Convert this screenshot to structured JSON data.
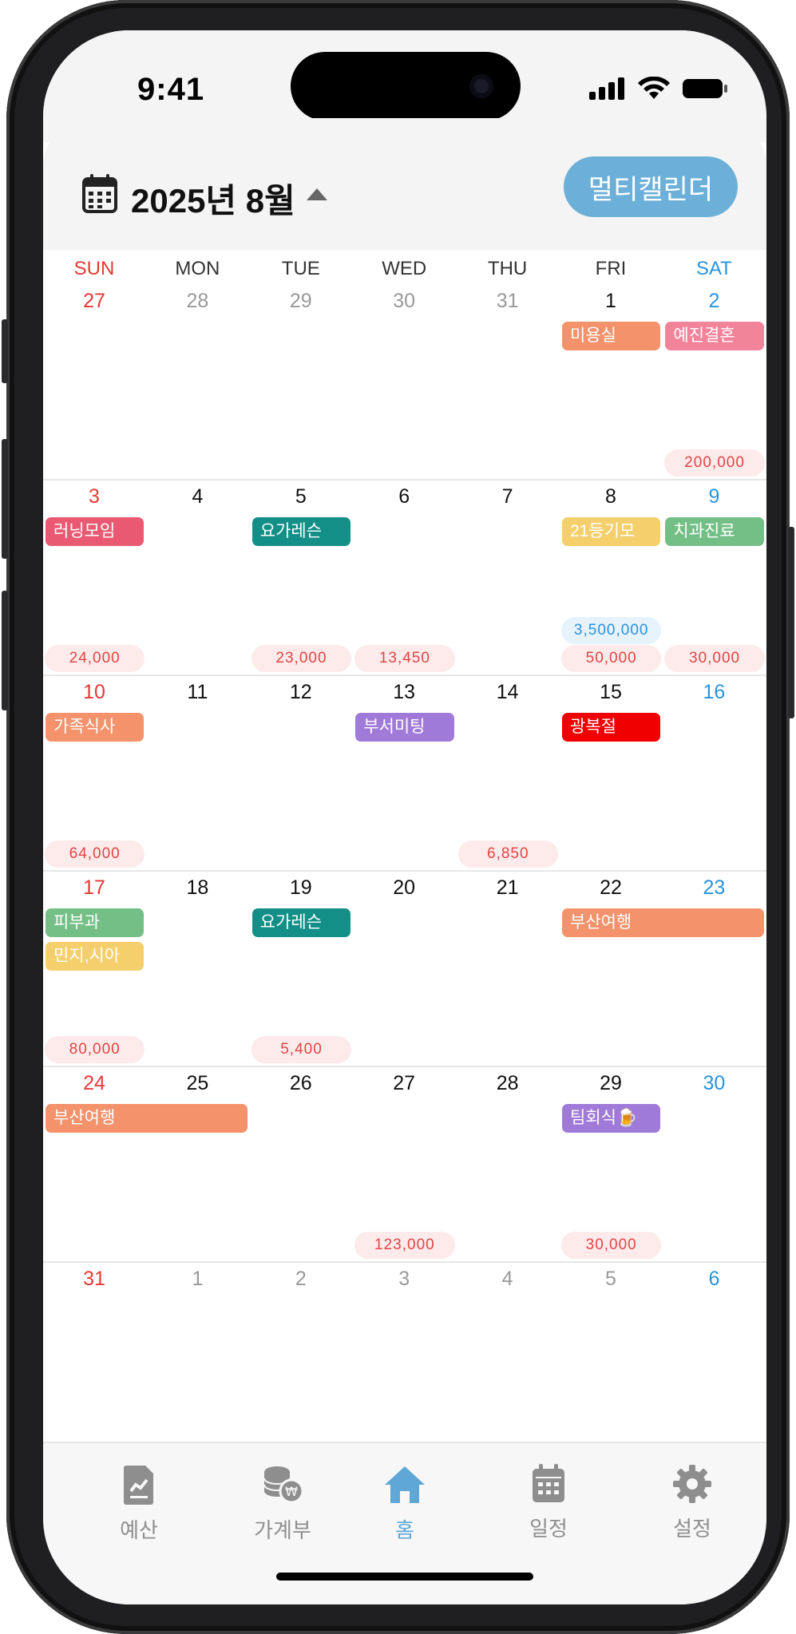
{
  "status": {
    "time": "9:41"
  },
  "header": {
    "month_title": "2025년 8월",
    "multi_button": "멀티캘린더"
  },
  "colors": {
    "accent": "#5fa7d6",
    "sunday": "#e53935",
    "saturday": "#2a93dd",
    "expense": "#e04545",
    "income": "#2a93dd"
  },
  "weekdays": [
    "SUN",
    "MON",
    "TUE",
    "WED",
    "THU",
    "FRI",
    "SAT"
  ],
  "weeks": [
    {
      "days": [
        "27",
        "28",
        "29",
        "30",
        "31",
        "1",
        "2"
      ],
      "events": [
        {
          "label": "미용실",
          "color": "#f4926b"
        },
        {
          "label": "예진결혼",
          "color": "#f2849a"
        }
      ],
      "amounts": [
        {
          "value": "200,000",
          "type": "expense"
        }
      ]
    },
    {
      "days": [
        "3",
        "4",
        "5",
        "6",
        "7",
        "8",
        "9"
      ],
      "events": [
        {
          "label": "러닝모임",
          "color": "#e95a72"
        },
        {
          "label": "요가레슨",
          "color": "#138f87"
        },
        {
          "label": "21등기모",
          "color": "#f5cf6b"
        },
        {
          "label": "치과진료",
          "color": "#74bf86"
        }
      ],
      "amounts": [
        {
          "value": "3,500,000",
          "type": "income"
        },
        {
          "value": "24,000",
          "type": "expense"
        },
        {
          "value": "23,000",
          "type": "expense"
        },
        {
          "value": "13,450",
          "type": "expense"
        },
        {
          "value": "50,000",
          "type": "expense"
        },
        {
          "value": "30,000",
          "type": "expense"
        }
      ]
    },
    {
      "days": [
        "10",
        "11",
        "12",
        "13",
        "14",
        "15",
        "16"
      ],
      "events": [
        {
          "label": "가족식사",
          "color": "#f4926b"
        },
        {
          "label": "부서미팅",
          "color": "#a07ad8"
        },
        {
          "label": "광복절",
          "color": "#f00000"
        }
      ],
      "amounts": [
        {
          "value": "64,000",
          "type": "expense"
        },
        {
          "value": "6,850",
          "type": "expense"
        }
      ]
    },
    {
      "days": [
        "17",
        "18",
        "19",
        "20",
        "21",
        "22",
        "23"
      ],
      "events": [
        {
          "label": "피부과",
          "color": "#74bf86"
        },
        {
          "label": "민지,시아",
          "color": "#f5cf6b"
        },
        {
          "label": "요가레슨",
          "color": "#138f87"
        },
        {
          "label": "부산여행",
          "color": "#f4926b"
        }
      ],
      "amounts": [
        {
          "value": "80,000",
          "type": "expense"
        },
        {
          "value": "5,400",
          "type": "expense"
        }
      ]
    },
    {
      "days": [
        "24",
        "25",
        "26",
        "27",
        "28",
        "29",
        "30"
      ],
      "events": [
        {
          "label": "부산여행",
          "color": "#f4926b"
        },
        {
          "label": "팀회식🍺",
          "color": "#a07ad8"
        }
      ],
      "amounts": [
        {
          "value": "123,000",
          "type": "expense"
        },
        {
          "value": "30,000",
          "type": "expense"
        }
      ]
    },
    {
      "days": [
        "31",
        "1",
        "2",
        "3",
        "4",
        "5",
        "6"
      ],
      "events": [],
      "amounts": []
    }
  ],
  "tabs": [
    {
      "label": "예산",
      "icon": "budget-icon"
    },
    {
      "label": "가계부",
      "icon": "coins-icon"
    },
    {
      "label": "홈",
      "icon": "home-icon",
      "active": true
    },
    {
      "label": "일정",
      "icon": "calendar-icon"
    },
    {
      "label": "설정",
      "icon": "gear-icon"
    }
  ]
}
